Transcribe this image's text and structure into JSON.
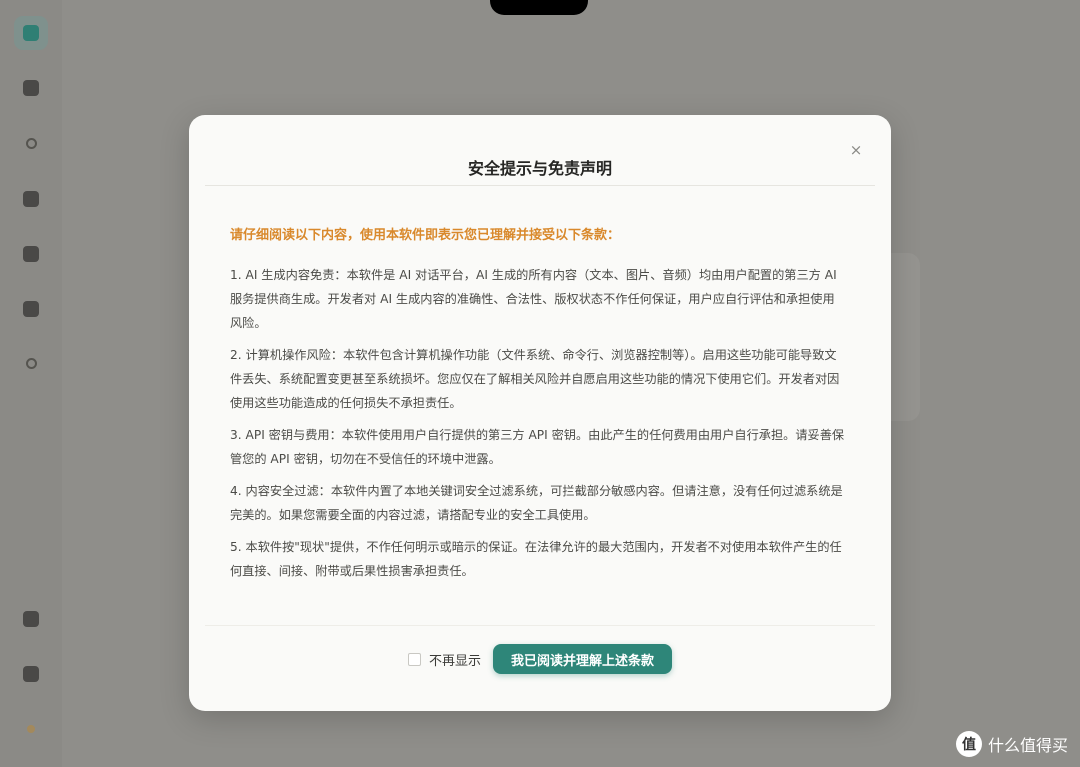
{
  "modal": {
    "title": "安全提示与免责声明",
    "close_icon": "×",
    "notice": "请仔细阅读以下内容，使用本软件即表示您已理解并接受以下条款：",
    "clauses": [
      "1. AI 生成内容免责：本软件是 AI 对话平台，AI 生成的所有内容（文本、图片、音频）均由用户配置的第三方 AI 服务提供商生成。开发者对 AI 生成内容的准确性、合法性、版权状态不作任何保证，用户应自行评估和承担使用风险。",
      "2. 计算机操作风险：本软件包含计算机操作功能（文件系统、命令行、浏览器控制等）。启用这些功能可能导致文件丢失、系统配置变更甚至系统损坏。您应仅在了解相关风险并自愿启用这些功能的情况下使用它们。开发者对因使用这些功能造成的任何损失不承担责任。",
      "3. API 密钥与费用：本软件使用用户自行提供的第三方 API 密钥。由此产生的任何费用由用户自行承担。请妥善保管您的 API 密钥，切勿在不受信任的环境中泄露。",
      "4. 内容安全过滤：本软件内置了本地关键词安全过滤系统，可拦截部分敏感内容。但请注意，没有任何过滤系统是完美的。如果您需要全面的内容过滤，请搭配专业的安全工具使用。",
      "5. 本软件按\"现状\"提供，不作任何明示或暗示的保证。在法律允许的最大范围内，开发者不对使用本软件产生的任何直接、间接、附带或后果性损害承担责任。"
    ],
    "checkbox_label": "不再显示",
    "confirm_label": "我已阅读并理解上述条款"
  },
  "watermark": {
    "logo": "值",
    "text": "什么值得买"
  },
  "colors": {
    "accent": "#2e8679",
    "notice": "#d9892c",
    "overlay": "#8f8e8a"
  }
}
